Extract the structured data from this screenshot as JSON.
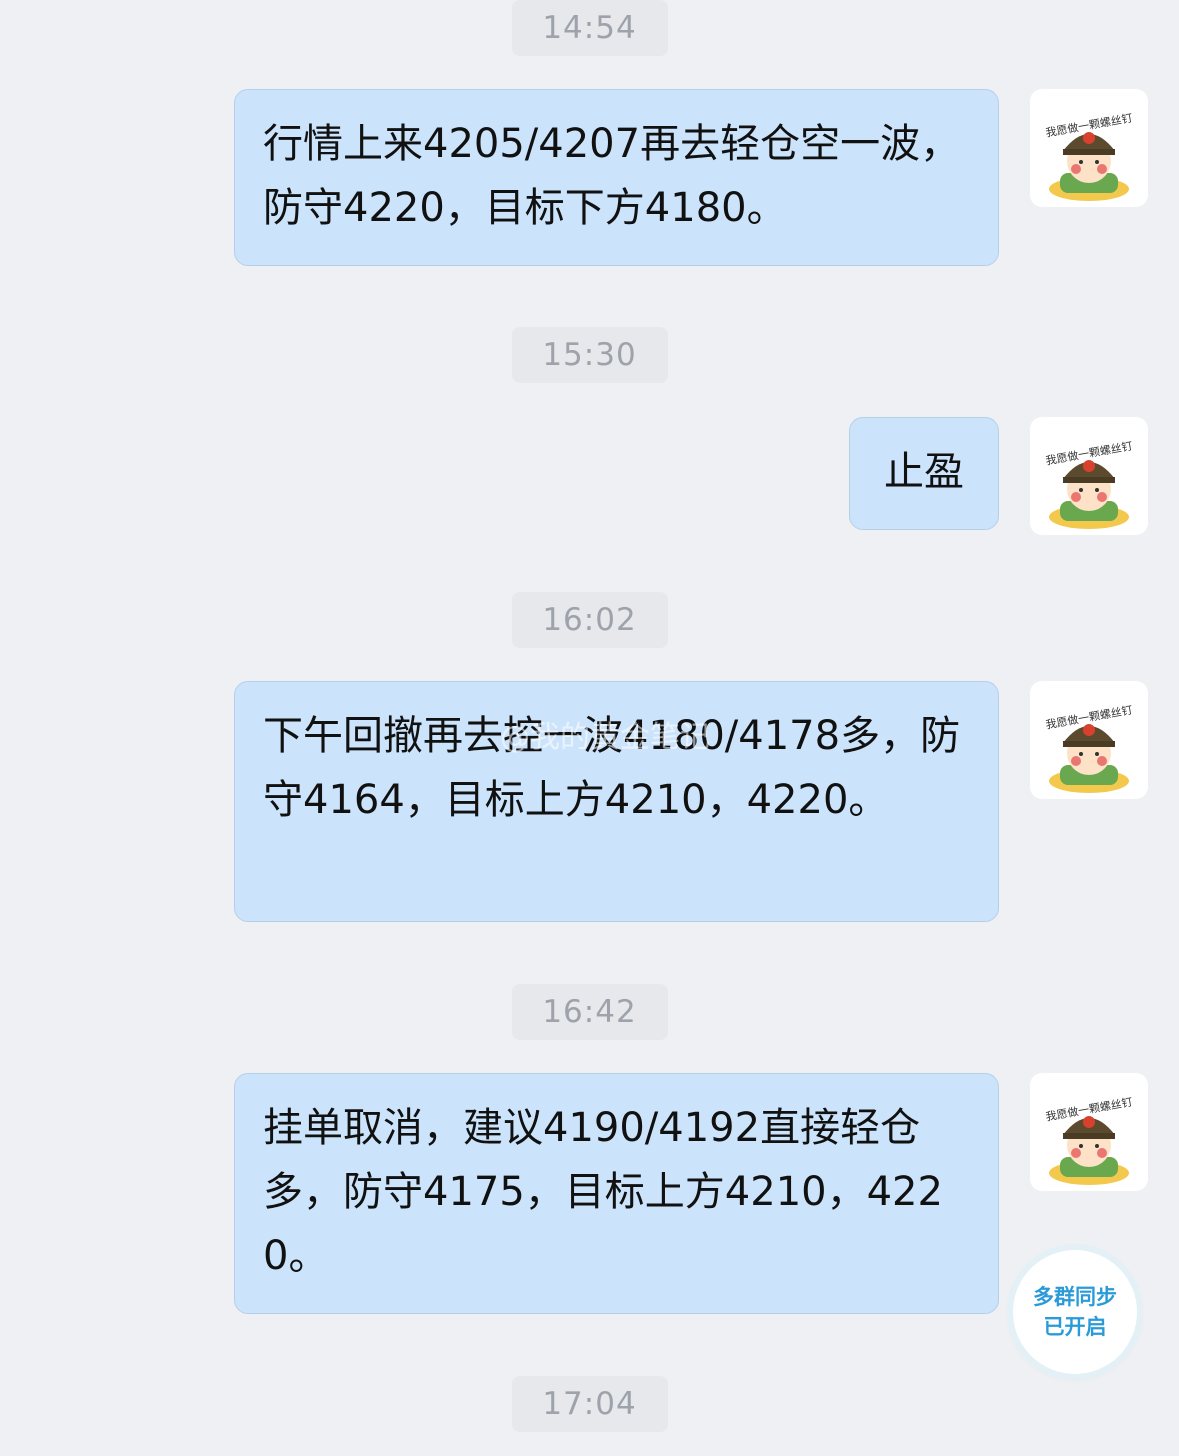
{
  "messages": [
    {
      "time": "14:54",
      "text": "行情上来4205/4207再去轻仓空一波，防守4220，目标下方4180。"
    },
    {
      "time": "15:30",
      "text": "止盈"
    },
    {
      "time": "16:02",
      "text": "下午回撤再去控一波4180/4178多，防守4164，目标上方4210，4220。"
    },
    {
      "time": "16:42",
      "text": "挂单取消，建议4190/4192直接轻仓多，防守4175，目标上方4210，4220。"
    },
    {
      "time": "17:04"
    }
  ],
  "watermark": "@我的黄金笔记",
  "sync_badge": {
    "line1": "多群同步",
    "line2": "已开启"
  },
  "avatar": {
    "caption": "我愿做一颗螺丝钉"
  },
  "colors": {
    "background": "#eef0f3",
    "bubble": "#cce4fb",
    "timestamp_text": "#9ea3ab",
    "badge_text": "#2b9bd8"
  }
}
